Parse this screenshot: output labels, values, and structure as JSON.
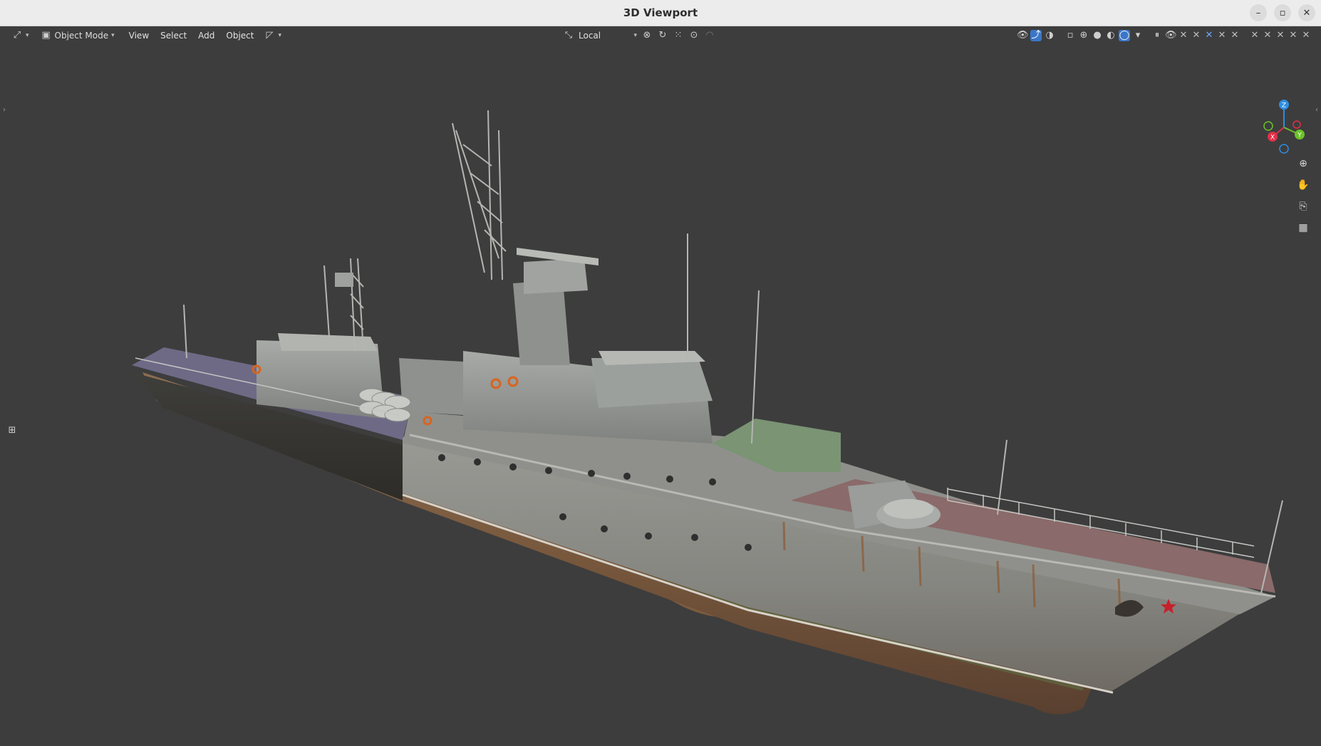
{
  "window": {
    "title": "3D Viewport"
  },
  "header": {
    "mode": {
      "label": "Object Mode"
    },
    "menus": [
      "View",
      "Select",
      "Add",
      "Object"
    ],
    "transform_orientation": {
      "label": "Local"
    }
  },
  "viewport": {
    "gizmo": {
      "x_label": "X",
      "y_label": "Y",
      "z_label": "Z"
    }
  },
  "colors": {
    "background": "#3d3d3d",
    "accent": "#3b76c8",
    "axis_x": "#e0304a",
    "axis_y": "#6cc32a",
    "axis_z": "#2f8ee0"
  }
}
